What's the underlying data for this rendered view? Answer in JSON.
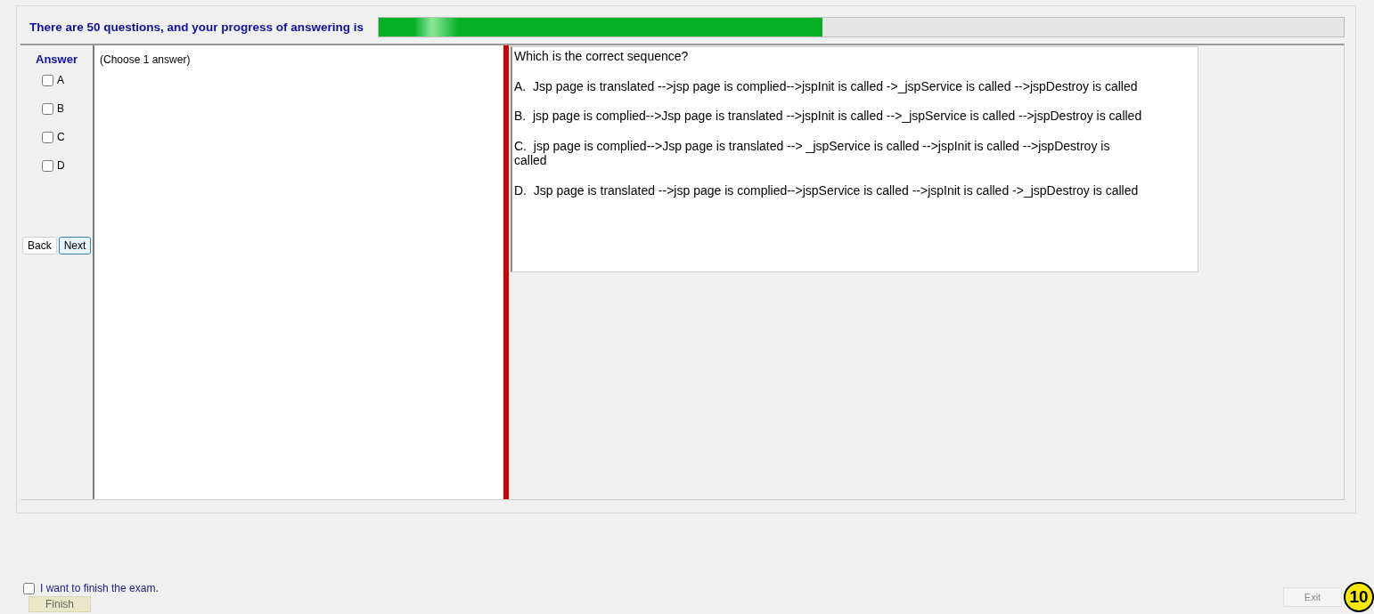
{
  "header": {
    "text": "There are 50 questions, and your progress of answering is",
    "progress": {
      "level": 0.46
    }
  },
  "answer_panel": {
    "title": "Answer",
    "choices": [
      {
        "label": "A",
        "checked": false
      },
      {
        "label": "B",
        "checked": false
      },
      {
        "label": "C",
        "checked": false
      },
      {
        "label": "D",
        "checked": false
      }
    ],
    "back_button": "Back",
    "next_button": "Next"
  },
  "instruction": "(Choose 1 answer)",
  "question": {
    "text": "Which is the correct sequence?",
    "options": [
      "A.  Jsp page is translated -->jsp page is complied-->jspInit is called ->_jspService is called -->jspDestroy is called",
      "B.  jsp page is complied-->Jsp page is translated -->jspInit is called -->_jspService is called -->jspDestroy is called",
      "C.  jsp page is complied-->Jsp page is translated --> _jspService is called -->jspInit is called -->jspDestroy is called",
      "D.  Jsp page is translated -->jsp page is complied-->jspService is called -->jspInit is called ->_jspDestroy is called"
    ]
  },
  "finish": {
    "checkbox_label": "I want to finish the exam.",
    "checked": false,
    "finish_button": "Finish"
  },
  "exit_button": "Exit",
  "badge": "10"
}
